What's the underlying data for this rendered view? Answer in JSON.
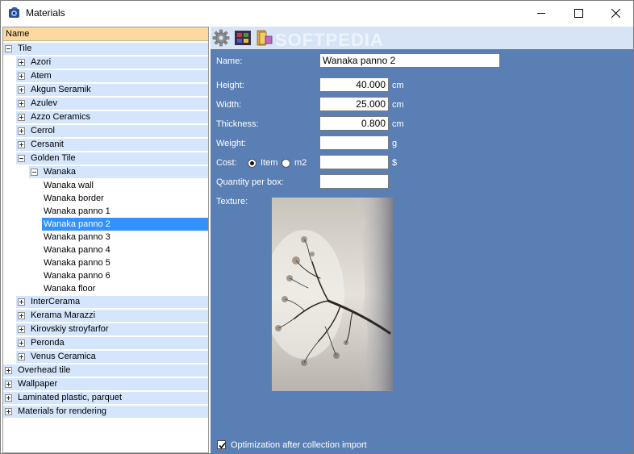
{
  "window": {
    "title": "Materials",
    "controls": {
      "minimize": "minimize",
      "maximize": "maximize",
      "close": "close"
    }
  },
  "tree": {
    "header": "Name",
    "rows": [
      {
        "label": "Tile",
        "level": 0,
        "expander": "minus"
      },
      {
        "label": "Azori",
        "level": 1,
        "expander": "plus"
      },
      {
        "label": "Atem",
        "level": 1,
        "expander": "plus"
      },
      {
        "label": "Akgun Seramik",
        "level": 1,
        "expander": "plus"
      },
      {
        "label": "Azulev",
        "level": 1,
        "expander": "plus"
      },
      {
        "label": "Azzo Ceramics",
        "level": 1,
        "expander": "plus"
      },
      {
        "label": "Cerrol",
        "level": 1,
        "expander": "plus"
      },
      {
        "label": "Cersanit",
        "level": 1,
        "expander": "plus"
      },
      {
        "label": "Golden Tile",
        "level": 1,
        "expander": "minus"
      },
      {
        "label": "Wanaka",
        "level": 2,
        "expander": "minus"
      },
      {
        "label": "Wanaka wall",
        "level": 3,
        "expander": "none"
      },
      {
        "label": "Wanaka border",
        "level": 3,
        "expander": "none"
      },
      {
        "label": "Wanaka panno 1",
        "level": 3,
        "expander": "none"
      },
      {
        "label": "Wanaka panno 2",
        "level": 3,
        "expander": "none",
        "selected": true
      },
      {
        "label": "Wanaka panno 3",
        "level": 3,
        "expander": "none"
      },
      {
        "label": "Wanaka panno 4",
        "level": 3,
        "expander": "none"
      },
      {
        "label": "Wanaka panno 5",
        "level": 3,
        "expander": "none"
      },
      {
        "label": "Wanaka panno 6",
        "level": 3,
        "expander": "none"
      },
      {
        "label": "Wanaka floor",
        "level": 3,
        "expander": "none"
      },
      {
        "label": "InterCerama",
        "level": 1,
        "expander": "plus"
      },
      {
        "label": "Kerama Marazzi",
        "level": 1,
        "expander": "plus"
      },
      {
        "label": "Kirovskiy stroyfarfor",
        "level": 1,
        "expander": "plus"
      },
      {
        "label": "Peronda",
        "level": 1,
        "expander": "plus"
      },
      {
        "label": "Venus Ceramica",
        "level": 1,
        "expander": "plus"
      },
      {
        "label": "Overhead tile",
        "level": 0,
        "expander": "plus"
      },
      {
        "label": "Wallpaper",
        "level": 0,
        "expander": "plus"
      },
      {
        "label": "Laminated plastic, parquet",
        "level": 0,
        "expander": "plus"
      },
      {
        "label": "Materials for rendering",
        "level": 0,
        "expander": "plus"
      }
    ]
  },
  "toolbar": {
    "icons": [
      "gear-icon",
      "film-icon",
      "folder-icon"
    ],
    "watermark": "SOFTPEDIA"
  },
  "form": {
    "name_label": "Name:",
    "name_value": "Wanaka panno 2",
    "height_label": "Height:",
    "height_value": "40.000",
    "height_unit": "cm",
    "width_label": "Width:",
    "width_value": "25.000",
    "width_unit": "cm",
    "thickness_label": "Thickness:",
    "thickness_value": "0.800",
    "thickness_unit": "cm",
    "weight_label": "Weight:",
    "weight_value": "",
    "weight_unit": "g",
    "cost_label": "Cost:",
    "cost_option_item": "Item",
    "cost_option_m2": "m2",
    "cost_selected": "Item",
    "cost_value": "",
    "cost_unit": "$",
    "qty_label": "Quantity per box:",
    "qty_value": "",
    "texture_label": "Texture:",
    "optimization_label": "Optimization after collection import",
    "optimization_checked": true
  },
  "colors": {
    "panel_bg": "#5a7fb5",
    "toolbar_bg": "#d7e4f5",
    "header_bg": "#fcd9a0",
    "row_highlight": "#d5e5fb",
    "selection": "#3390ff"
  }
}
